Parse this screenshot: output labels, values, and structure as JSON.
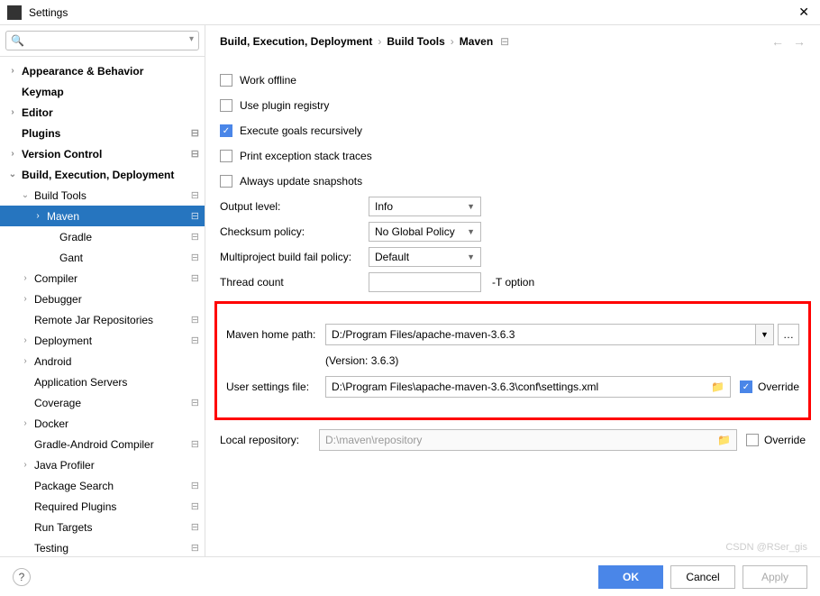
{
  "window": {
    "title": "Settings"
  },
  "search": {
    "placeholder": ""
  },
  "sidebar": {
    "items": [
      {
        "label": "Appearance & Behavior",
        "arrow": ">",
        "bold": true,
        "indent": 0
      },
      {
        "label": "Keymap",
        "arrow": "",
        "bold": true,
        "indent": 0
      },
      {
        "label": "Editor",
        "arrow": ">",
        "bold": true,
        "indent": 0
      },
      {
        "label": "Plugins",
        "arrow": "",
        "bold": true,
        "indent": 0,
        "gear": true
      },
      {
        "label": "Version Control",
        "arrow": ">",
        "bold": true,
        "indent": 0,
        "gear": true
      },
      {
        "label": "Build, Execution, Deployment",
        "arrow": "v",
        "bold": true,
        "indent": 0
      },
      {
        "label": "Build Tools",
        "arrow": "v",
        "bold": false,
        "indent": 1,
        "gear": true
      },
      {
        "label": "Maven",
        "arrow": ">",
        "bold": false,
        "indent": 2,
        "selected": true,
        "gear": true
      },
      {
        "label": "Gradle",
        "arrow": "",
        "bold": false,
        "indent": 3,
        "gear": true
      },
      {
        "label": "Gant",
        "arrow": "",
        "bold": false,
        "indent": 3,
        "gear": true
      },
      {
        "label": "Compiler",
        "arrow": ">",
        "bold": false,
        "indent": 1,
        "gear": true
      },
      {
        "label": "Debugger",
        "arrow": ">",
        "bold": false,
        "indent": 1
      },
      {
        "label": "Remote Jar Repositories",
        "arrow": "",
        "bold": false,
        "indent": 1,
        "gear": true
      },
      {
        "label": "Deployment",
        "arrow": ">",
        "bold": false,
        "indent": 1,
        "gear": true
      },
      {
        "label": "Android",
        "arrow": ">",
        "bold": false,
        "indent": 1
      },
      {
        "label": "Application Servers",
        "arrow": "",
        "bold": false,
        "indent": 1
      },
      {
        "label": "Coverage",
        "arrow": "",
        "bold": false,
        "indent": 1,
        "gear": true
      },
      {
        "label": "Docker",
        "arrow": ">",
        "bold": false,
        "indent": 1
      },
      {
        "label": "Gradle-Android Compiler",
        "arrow": "",
        "bold": false,
        "indent": 1,
        "gear": true
      },
      {
        "label": "Java Profiler",
        "arrow": ">",
        "bold": false,
        "indent": 1
      },
      {
        "label": "Package Search",
        "arrow": "",
        "bold": false,
        "indent": 1,
        "gear": true
      },
      {
        "label": "Required Plugins",
        "arrow": "",
        "bold": false,
        "indent": 1,
        "gear": true
      },
      {
        "label": "Run Targets",
        "arrow": "",
        "bold": false,
        "indent": 1,
        "gear": true
      },
      {
        "label": "Testing",
        "arrow": "",
        "bold": false,
        "indent": 1,
        "gear": true
      }
    ]
  },
  "breadcrumb": {
    "c1": "Build, Execution, Deployment",
    "c2": "Build Tools",
    "c3": "Maven"
  },
  "checks": {
    "work_offline": "Work offline",
    "use_plugin_registry": "Use plugin registry",
    "execute_goals": "Execute goals recursively",
    "print_exception": "Print exception stack traces",
    "always_update": "Always update snapshots"
  },
  "fields": {
    "output_level_label": "Output level:",
    "output_level_value": "Info",
    "checksum_label": "Checksum policy:",
    "checksum_value": "No Global Policy",
    "multiproject_label": "Multiproject build fail policy:",
    "multiproject_value": "Default",
    "thread_label": "Thread count",
    "thread_suffix": "-T option",
    "maven_home_label": "Maven home path:",
    "maven_home_value": "D:/Program Files/apache-maven-3.6.3",
    "version": "(Version: 3.6.3)",
    "user_settings_label": "User settings file:",
    "user_settings_value": "D:\\Program Files\\apache-maven-3.6.3\\conf\\settings.xml",
    "local_repo_label": "Local repository:",
    "local_repo_value": "D:\\maven\\repository",
    "override": "Override"
  },
  "buttons": {
    "ok": "OK",
    "cancel": "Cancel",
    "apply": "Apply"
  },
  "watermark": "CSDN @RSer_gis"
}
